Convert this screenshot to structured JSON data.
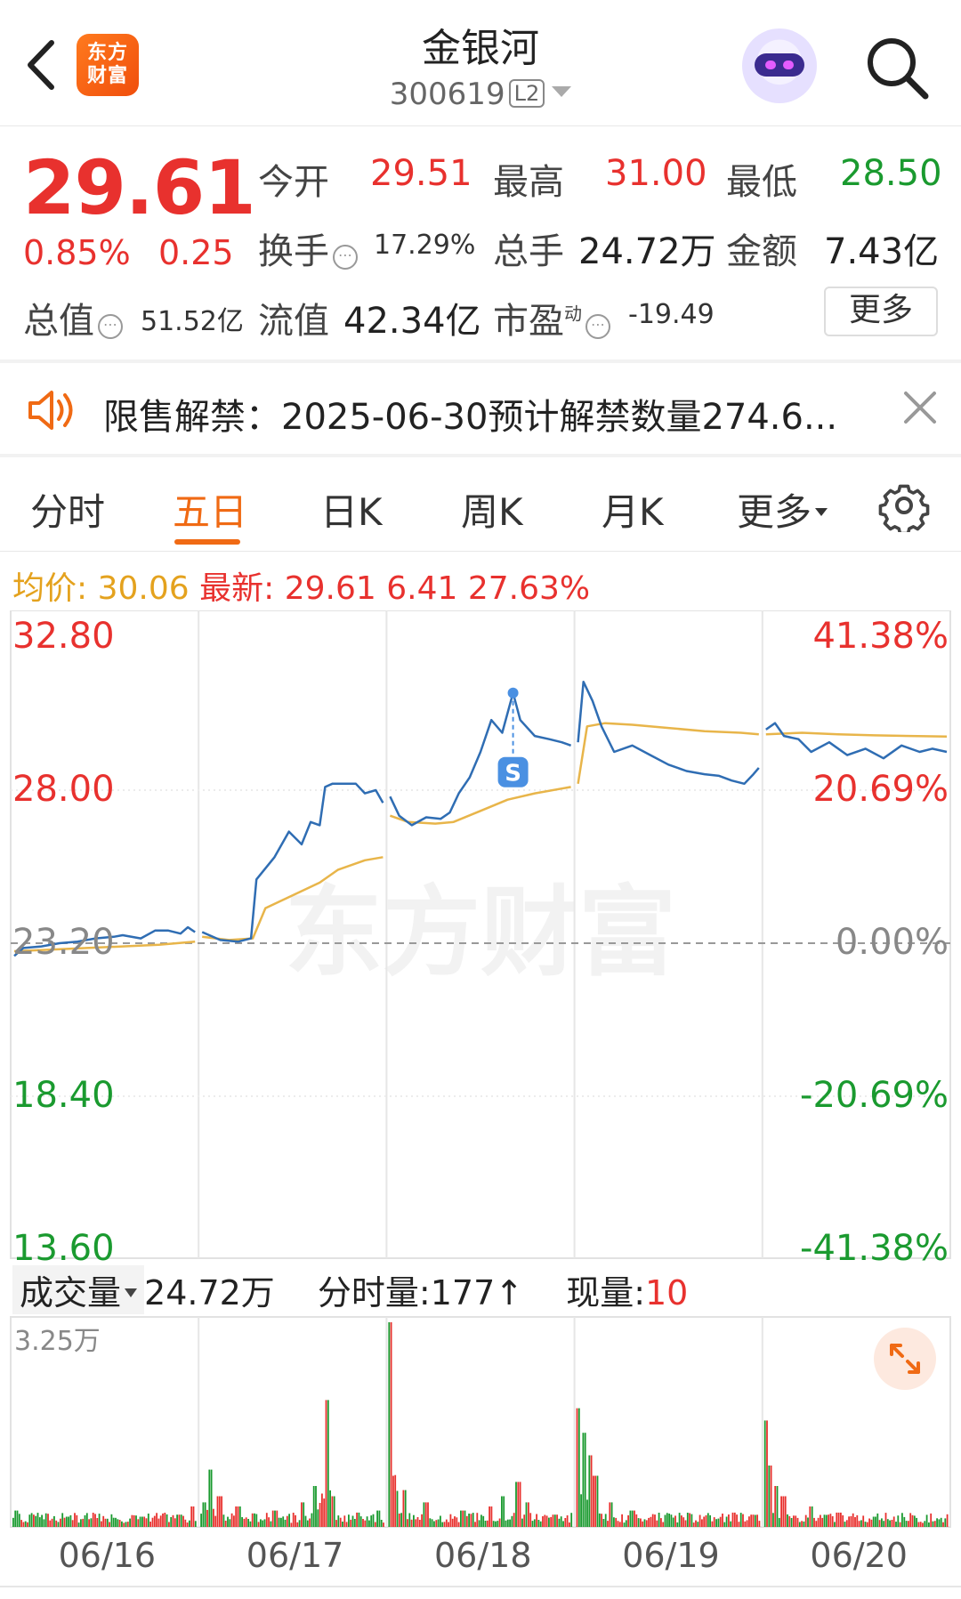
{
  "header": {
    "stock_name": "金银河",
    "stock_code": "300619",
    "level_badge": "L2",
    "brand_logo_text_line1": "东方",
    "brand_logo_text_line2": "财富"
  },
  "quote": {
    "price": "29.61",
    "change_pct": "0.85%",
    "change_amt": "0.25",
    "open_label": "今开",
    "open": "29.51",
    "high_label": "最高",
    "high": "31.00",
    "low_label": "最低",
    "low": "28.50",
    "turnover_label": "换手",
    "turnover": "17.29%",
    "volume_label": "总手",
    "volume": "24.72万",
    "amount_label": "金额",
    "amount": "7.43亿",
    "mktcap_label": "总值",
    "mktcap": "51.52亿",
    "float_label": "流值",
    "float_cap": "42.34亿",
    "pe_label": "市盈",
    "pe_sup": "动",
    "pe": "-19.49",
    "more_label": "更多"
  },
  "notice": {
    "text": "限售解禁：2025-06-30预计解禁数量274.6..."
  },
  "tabs": [
    {
      "label": "分时"
    },
    {
      "label": "五日",
      "active": true
    },
    {
      "label": "日K"
    },
    {
      "label": "周K"
    },
    {
      "label": "月K"
    },
    {
      "label": "更多"
    }
  ],
  "avg_row": {
    "avg_label": "均价:",
    "avg_value": "30.06",
    "latest_label": "最新:",
    "latest_value": "29.61",
    "change": "6.41",
    "change_pct": "27.63%"
  },
  "chart_data": {
    "type": "line",
    "title": "",
    "y_left_ticks": [
      "32.80",
      "28.00",
      "23.20",
      "18.40",
      "13.60"
    ],
    "y_right_ticks": [
      "41.38%",
      "20.69%",
      "0.00%",
      "-20.69%",
      "-41.38%"
    ],
    "ylim": [
      13.6,
      32.8
    ],
    "baseline": 23.2,
    "x_categories": [
      "06/16",
      "06/17",
      "06/18",
      "06/19",
      "06/20"
    ],
    "series": [
      {
        "name": "",
        "color": "#2f6db3",
        "values": [
          [
            [
              0,
              22.8
            ],
            [
              0.05,
              23.05
            ],
            [
              0.15,
              23.1
            ],
            [
              0.25,
              23.2
            ],
            [
              0.35,
              23.25
            ],
            [
              0.45,
              23.35
            ],
            [
              0.55,
              23.4
            ],
            [
              0.6,
              23.45
            ],
            [
              0.7,
              23.35
            ],
            [
              0.78,
              23.6
            ],
            [
              0.85,
              23.6
            ],
            [
              0.92,
              23.5
            ],
            [
              0.96,
              23.7
            ],
            [
              1.0,
              23.55
            ]
          ],
          [
            [
              0,
              23.55
            ],
            [
              0.1,
              23.3
            ],
            [
              0.2,
              23.25
            ],
            [
              0.27,
              23.35
            ],
            [
              0.3,
              25.2
            ],
            [
              0.4,
              25.9
            ],
            [
              0.48,
              26.7
            ],
            [
              0.55,
              26.3
            ],
            [
              0.6,
              27.0
            ],
            [
              0.65,
              26.9
            ],
            [
              0.68,
              28.1
            ],
            [
              0.72,
              28.2
            ],
            [
              0.78,
              28.2
            ],
            [
              0.85,
              28.2
            ],
            [
              0.9,
              27.9
            ],
            [
              0.96,
              28.0
            ],
            [
              1.0,
              27.6
            ]
          ],
          [
            [
              0,
              27.8
            ],
            [
              0.05,
              27.2
            ],
            [
              0.12,
              26.9
            ],
            [
              0.2,
              27.15
            ],
            [
              0.28,
              27.1
            ],
            [
              0.33,
              27.3
            ],
            [
              0.38,
              27.9
            ],
            [
              0.44,
              28.4
            ],
            [
              0.5,
              29.2
            ],
            [
              0.56,
              30.2
            ],
            [
              0.62,
              29.8
            ],
            [
              0.68,
              31.05
            ],
            [
              0.72,
              30.2
            ],
            [
              0.8,
              29.7
            ],
            [
              0.88,
              29.6
            ],
            [
              0.95,
              29.5
            ],
            [
              1.0,
              29.4
            ]
          ],
          [
            [
              0,
              29.5
            ],
            [
              0.03,
              31.4
            ],
            [
              0.08,
              30.8
            ],
            [
              0.13,
              30.0
            ],
            [
              0.2,
              29.2
            ],
            [
              0.3,
              29.4
            ],
            [
              0.4,
              29.1
            ],
            [
              0.5,
              28.8
            ],
            [
              0.6,
              28.6
            ],
            [
              0.7,
              28.5
            ],
            [
              0.78,
              28.45
            ],
            [
              0.85,
              28.3
            ],
            [
              0.92,
              28.2
            ],
            [
              0.97,
              28.5
            ],
            [
              1.0,
              28.7
            ]
          ],
          [
            [
              0,
              29.9
            ],
            [
              0.05,
              30.1
            ],
            [
              0.1,
              29.7
            ],
            [
              0.18,
              29.6
            ],
            [
              0.25,
              29.2
            ],
            [
              0.35,
              29.5
            ],
            [
              0.45,
              29.1
            ],
            [
              0.55,
              29.3
            ],
            [
              0.65,
              29.0
            ],
            [
              0.75,
              29.4
            ],
            [
              0.85,
              29.2
            ],
            [
              0.92,
              29.3
            ],
            [
              1.0,
              29.2
            ]
          ]
        ]
      },
      {
        "name": "",
        "color": "#e8b54a",
        "values": [
          [
            [
              0,
              22.95
            ],
            [
              0.2,
              23.0
            ],
            [
              0.4,
              23.05
            ],
            [
              0.6,
              23.1
            ],
            [
              0.8,
              23.15
            ],
            [
              1.0,
              23.25
            ]
          ],
          [
            [
              0,
              23.4
            ],
            [
              0.15,
              23.3
            ],
            [
              0.28,
              23.35
            ],
            [
              0.35,
              24.3
            ],
            [
              0.5,
              24.7
            ],
            [
              0.65,
              25.1
            ],
            [
              0.75,
              25.5
            ],
            [
              0.9,
              25.8
            ],
            [
              1.0,
              25.9
            ]
          ],
          [
            [
              0,
              27.2
            ],
            [
              0.1,
              27.0
            ],
            [
              0.25,
              26.95
            ],
            [
              0.35,
              27.0
            ],
            [
              0.5,
              27.35
            ],
            [
              0.65,
              27.7
            ],
            [
              0.8,
              27.9
            ],
            [
              1.0,
              28.1
            ]
          ],
          [
            [
              0,
              28.2
            ],
            [
              0.05,
              30.0
            ],
            [
              0.15,
              30.1
            ],
            [
              0.3,
              30.05
            ],
            [
              0.5,
              29.95
            ],
            [
              0.7,
              29.85
            ],
            [
              0.9,
              29.8
            ],
            [
              1.0,
              29.75
            ]
          ],
          [
            [
              0,
              29.75
            ],
            [
              0.2,
              29.8
            ],
            [
              0.4,
              29.75
            ],
            [
              0.6,
              29.72
            ],
            [
              0.8,
              29.7
            ],
            [
              1.0,
              29.68
            ]
          ]
        ]
      }
    ],
    "volume": {
      "max_label": "3.25万",
      "days": [
        {
          "spikes": [
            [
              0.02,
              0.08
            ],
            [
              0.1,
              0.06
            ],
            [
              0.3,
              0.05
            ],
            [
              0.5,
              0.04
            ],
            [
              0.7,
              0.05
            ],
            [
              0.9,
              0.06
            ],
            [
              0.97,
              0.1
            ]
          ]
        },
        {
          "spikes": [
            [
              0.02,
              0.12
            ],
            [
              0.05,
              0.28
            ],
            [
              0.1,
              0.15
            ],
            [
              0.2,
              0.1
            ],
            [
              0.4,
              0.08
            ],
            [
              0.55,
              0.12
            ],
            [
              0.62,
              0.2
            ],
            [
              0.68,
              0.62
            ],
            [
              0.72,
              0.15
            ],
            [
              0.85,
              0.07
            ],
            [
              0.96,
              0.08
            ]
          ]
        },
        {
          "spikes": [
            [
              0.0,
              1.0
            ],
            [
              0.03,
              0.25
            ],
            [
              0.08,
              0.18
            ],
            [
              0.2,
              0.12
            ],
            [
              0.4,
              0.08
            ],
            [
              0.55,
              0.1
            ],
            [
              0.62,
              0.15
            ],
            [
              0.7,
              0.22
            ],
            [
              0.75,
              0.12
            ],
            [
              0.9,
              0.06
            ]
          ]
        },
        {
          "spikes": [
            [
              0.0,
              0.58
            ],
            [
              0.04,
              0.46
            ],
            [
              0.07,
              0.35
            ],
            [
              0.1,
              0.25
            ],
            [
              0.18,
              0.12
            ],
            [
              0.3,
              0.08
            ],
            [
              0.5,
              0.06
            ],
            [
              0.7,
              0.05
            ],
            [
              0.85,
              0.07
            ],
            [
              0.95,
              0.06
            ]
          ]
        },
        {
          "spikes": [
            [
              0.0,
              0.52
            ],
            [
              0.03,
              0.3
            ],
            [
              0.06,
              0.2
            ],
            [
              0.1,
              0.15
            ],
            [
              0.25,
              0.1
            ],
            [
              0.4,
              0.07
            ],
            [
              0.6,
              0.05
            ],
            [
              0.8,
              0.04
            ],
            [
              0.95,
              0.03
            ]
          ]
        }
      ]
    }
  },
  "volume_row": {
    "volume_tag": "成交量",
    "total": "24.72万",
    "minute_vol_label": "分时量:",
    "minute_vol": "177",
    "current_label": "现量:",
    "current_value": "10"
  },
  "watermark": "东方财富",
  "colors": {
    "up": "#e8312e",
    "down": "#1a9a2f",
    "accent": "#f06a14",
    "avg_line": "#e8b54a",
    "price_line": "#2f6db3"
  }
}
